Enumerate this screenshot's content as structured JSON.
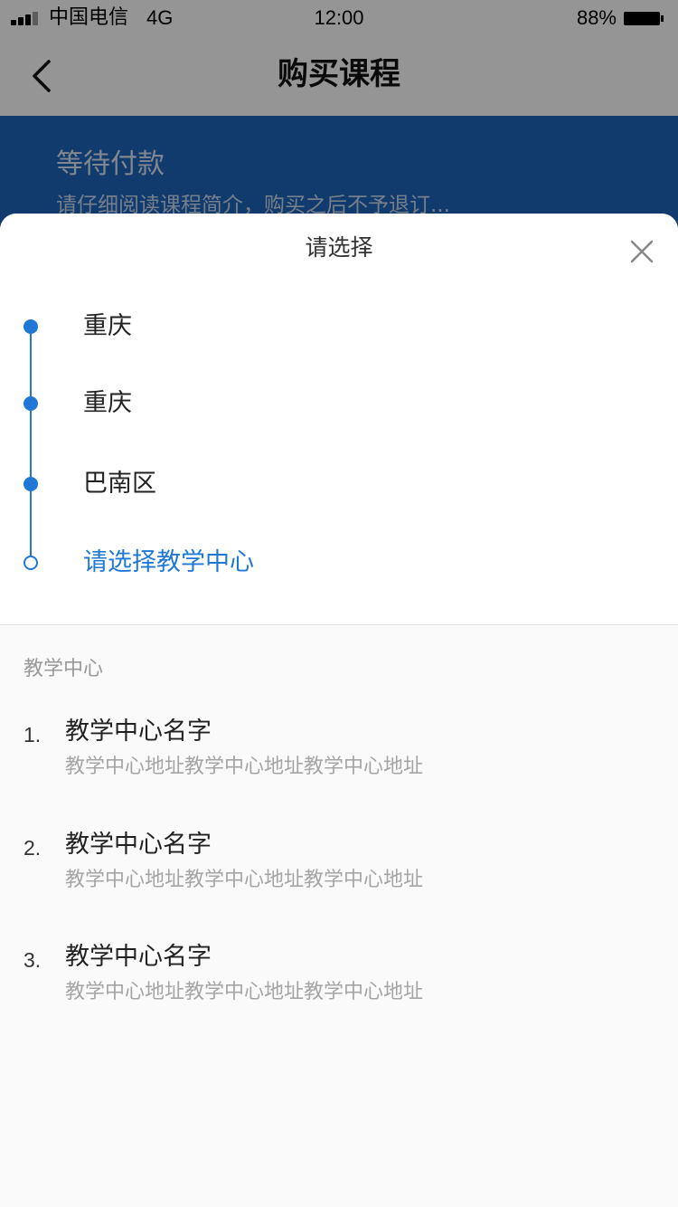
{
  "status_bar": {
    "carrier": "中国电信",
    "network": "4G",
    "time": "12:00",
    "battery": "88%"
  },
  "nav": {
    "title": "购买课程"
  },
  "hero": {
    "title": "等待付款",
    "subtitle": "请仔细阅读课程简介，购买之后不予退订..."
  },
  "sheet": {
    "title": "请选择",
    "steps": [
      {
        "label": "重庆",
        "state": "done"
      },
      {
        "label": "重庆",
        "state": "done"
      },
      {
        "label": "巴南区",
        "state": "done"
      },
      {
        "label": "请选择教学中心",
        "state": "active"
      }
    ],
    "section_label": "教学中心",
    "centers": [
      {
        "index": "1.",
        "name": "教学中心名字",
        "address": "教学中心地址教学中心地址教学中心地址"
      },
      {
        "index": "2.",
        "name": "教学中心名字",
        "address": "教学中心地址教学中心地址教学中心地址"
      },
      {
        "index": "3.",
        "name": "教学中心名字",
        "address": "教学中心地址教学中心地址教学中心地址"
      }
    ]
  },
  "colors": {
    "accent": "#1f78d6",
    "hero": "#1d61b6"
  },
  "icons": {
    "back": "chevron-left-icon",
    "close": "close-icon"
  }
}
